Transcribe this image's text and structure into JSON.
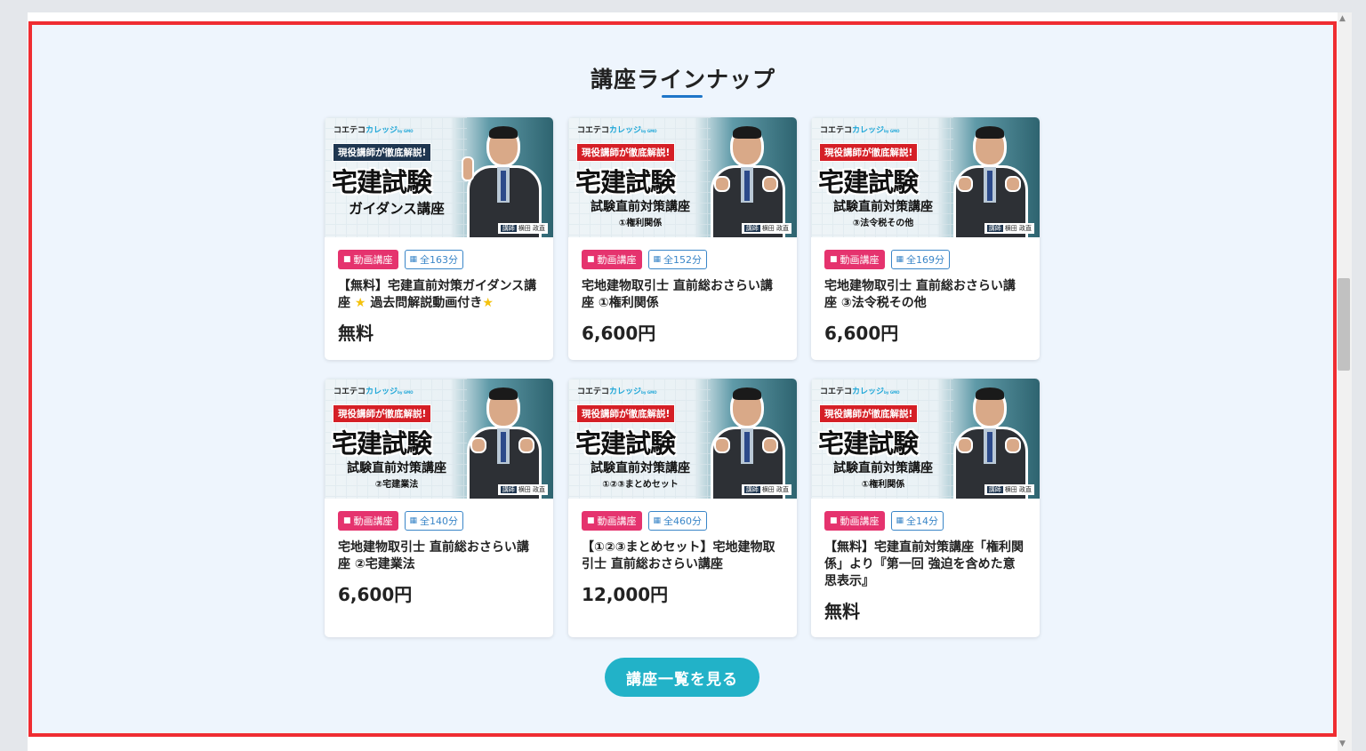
{
  "section": {
    "heading": "講座ラインナップ",
    "cta_label": "講座一覧を見る"
  },
  "colors": {
    "highlight_border": "#ef2d32",
    "section_bg": "#eef5fd",
    "video_badge": "#e5336e",
    "time_badge": "#3a86c8",
    "cta": "#22b2c8",
    "heading_underline": "#1e76c9"
  },
  "thumbnail": {
    "brand_a": "コエテコ",
    "brand_b": "カレッジ",
    "brand_c": "by GMO",
    "tagline": "現役講師が徹底解説!",
    "main": "宅建試験",
    "instructor_label": "講師",
    "instructor_name": "横田 政直"
  },
  "courses": [
    {
      "badge_type": "動画講座",
      "duration": "全163分",
      "title_a": "【無料】宅建直前対策ガイダンス講座",
      "title_b": "過去問解説動画付き",
      "price": "無料",
      "thumb_sub": "ガイダンス講座",
      "thumb_sub2": ""
    },
    {
      "badge_type": "動画講座",
      "duration": "全152分",
      "title_a": "宅地建物取引士 直前総おさらい講座 ①権利関係",
      "title_b": "",
      "price": "6,600円",
      "thumb_sub": "試験直前対策講座",
      "thumb_sub2": "①権利関係"
    },
    {
      "badge_type": "動画講座",
      "duration": "全169分",
      "title_a": "宅地建物取引士 直前総おさらい講座 ③法令税その他",
      "title_b": "",
      "price": "6,600円",
      "thumb_sub": "試験直前対策講座",
      "thumb_sub2": "③法令税その他"
    },
    {
      "badge_type": "動画講座",
      "duration": "全140分",
      "title_a": "宅地建物取引士 直前総おさらい講座 ②宅建業法",
      "title_b": "",
      "price": "6,600円",
      "thumb_sub": "試験直前対策講座",
      "thumb_sub2": "②宅建業法"
    },
    {
      "badge_type": "動画講座",
      "duration": "全460分",
      "title_a": "【①②③まとめセット】宅地建物取引士 直前総おさらい講座",
      "title_b": "",
      "price": "12,000円",
      "thumb_sub": "試験直前対策講座",
      "thumb_sub2": "①②③まとめセット"
    },
    {
      "badge_type": "動画講座",
      "duration": "全14分",
      "title_a": "【無料】宅建直前対策講座「権利関係」より『第一回 強迫を含めた意思表示』",
      "title_b": "",
      "price": "無料",
      "thumb_sub": "試験直前対策講座",
      "thumb_sub2": "①権利関係"
    }
  ]
}
